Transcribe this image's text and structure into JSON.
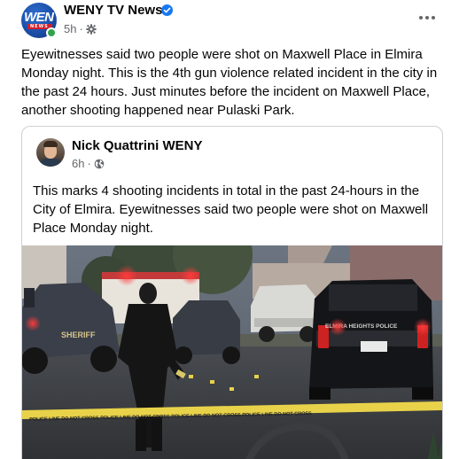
{
  "post": {
    "page_name": "WENY TV News",
    "avatar_logo_text": "WENY",
    "avatar_logo_sub": "NEWS",
    "time": "5h",
    "dot": "·",
    "body": "Eyewitnesses said two people were shot on Maxwell Place in Elmira Monday night. This is the 4th gun violence related incident in the city in the past 24 hours. Just minutes before the incident on Maxwell Place, another shooting happened near Pulaski Park."
  },
  "shared": {
    "author": "Nick Quattrini WENY",
    "time": "6h",
    "dot": "·",
    "body": "This marks 4 shooting incidents in total in the past 24-hours in the City of Elmira. Eyewitnesses said two people were shot on Maxwell Place Monday night.",
    "photo": {
      "sheriff_text": "SHERIFF",
      "suv_text": "ELMIRA HEIGHTS POLICE",
      "tape_text": "POLICE LINE DO NOT CROSS   POLICE LINE DO NOT CROSS   POLICE LINE DO NOT CROSS   POLICE LINE DO NOT CROSS"
    }
  },
  "colors": {
    "link_blue": "#1877f2",
    "secondary_text": "#65676b",
    "online_green": "#31a24c",
    "tape_yellow": "#e8d24a"
  },
  "icons": [
    "verified-badge-icon",
    "settings-gear-icon",
    "globe-icon",
    "more-options-icon"
  ]
}
